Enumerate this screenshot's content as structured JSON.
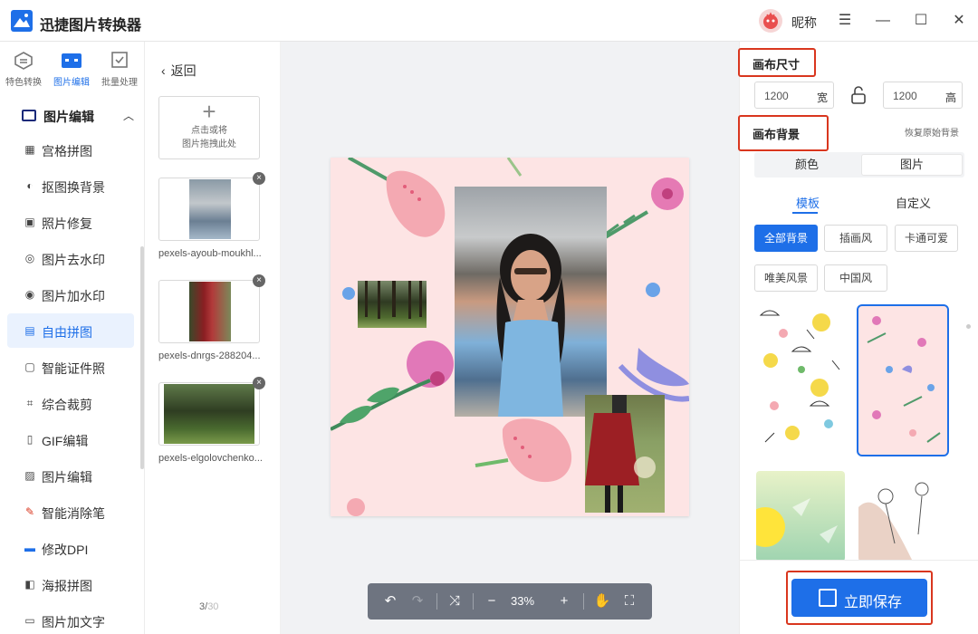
{
  "app": {
    "title": "迅捷图片转换器",
    "user_name": "昵称"
  },
  "modes": [
    {
      "label": "特色转换"
    },
    {
      "label": "图片编辑"
    },
    {
      "label": "批量处理"
    }
  ],
  "nav": {
    "header": "图片编辑",
    "items": [
      {
        "label": "宫格拼图",
        "icon": "grid-icon"
      },
      {
        "label": "抠图换背景",
        "icon": "cutout-icon"
      },
      {
        "label": "照片修复",
        "icon": "photo-repair-icon"
      },
      {
        "label": "图片去水印",
        "icon": "remove-watermark-icon"
      },
      {
        "label": "图片加水印",
        "icon": "add-watermark-icon"
      },
      {
        "label": "自由拼图",
        "icon": "free-collage-icon"
      },
      {
        "label": "智能证件照",
        "icon": "id-photo-icon"
      },
      {
        "label": "综合裁剪",
        "icon": "crop-icon"
      },
      {
        "label": "GIF编辑",
        "icon": "gif-icon"
      },
      {
        "label": "图片编辑",
        "icon": "image-edit-icon"
      },
      {
        "label": "智能消除笔",
        "icon": "eraser-pen-icon"
      },
      {
        "label": "修改DPI",
        "icon": "dpi-icon"
      },
      {
        "label": "海报拼图",
        "icon": "poster-icon"
      },
      {
        "label": "图片加文字",
        "icon": "add-text-icon"
      }
    ]
  },
  "images": {
    "back_label": "返回",
    "upload_line1": "点击或将",
    "upload_line2": "图片拖拽此处",
    "files": [
      {
        "name": "pexels-ayoub-moukhl..."
      },
      {
        "name": "pexels-dnrgs-288204..."
      },
      {
        "name": "pexels-elgolovchenko..."
      }
    ],
    "page_current": "3/",
    "page_total": "30"
  },
  "toolbar": {
    "zoom": "33%"
  },
  "right": {
    "canvas_size_title": "画布尺寸",
    "width_value": "1200",
    "width_unit": "宽",
    "height_value": "1200",
    "height_unit": "高",
    "canvas_bg_title": "画布背景",
    "restore_label": "恢复原始背景",
    "seg_color": "颜色",
    "seg_image": "图片",
    "tab_template": "模板",
    "tab_custom": "自定义",
    "categories": [
      "全部背景",
      "插画风",
      "卡通可爱",
      "唯美风景",
      "中国风"
    ],
    "save_label": "立即保存"
  },
  "colors": {
    "accent": "#1e6fe8",
    "highlight": "#d9361e",
    "canvas_bg": "#fde4e4"
  }
}
